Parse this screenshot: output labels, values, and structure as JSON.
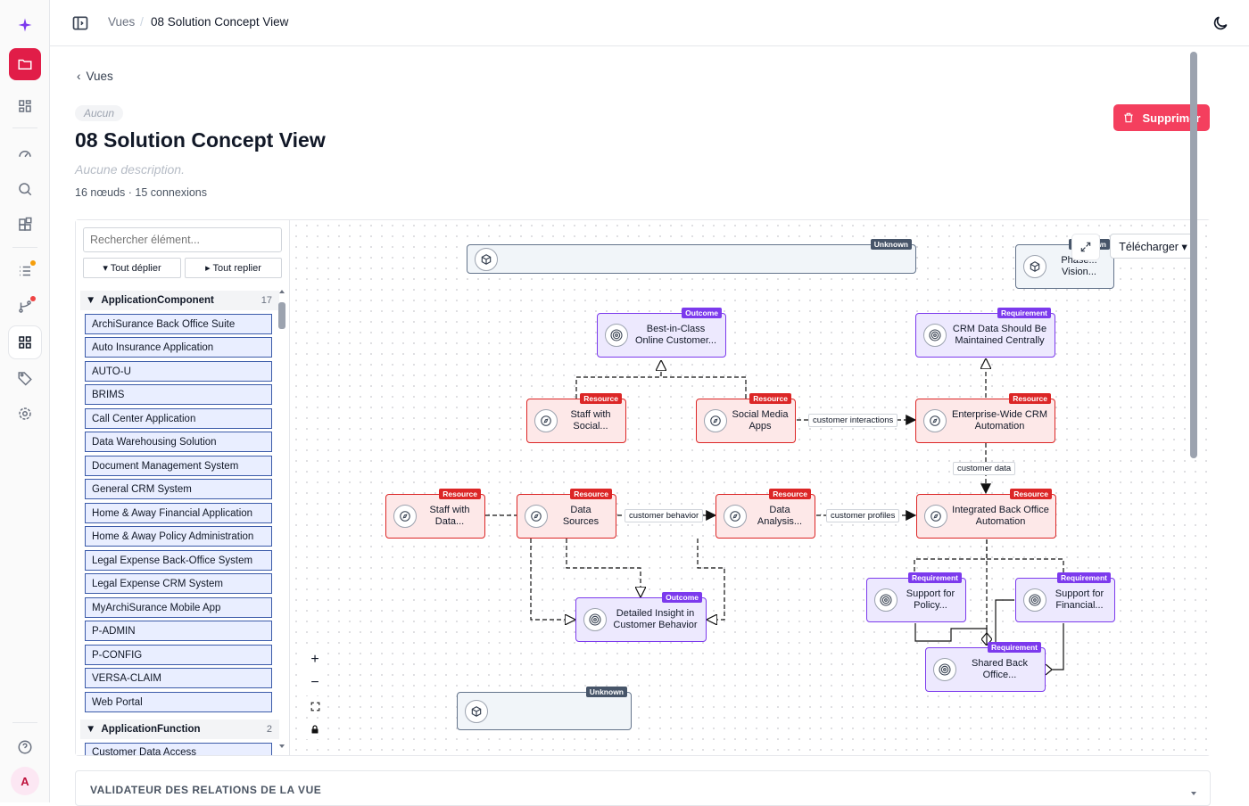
{
  "breadcrumb": {
    "parent": "Vues",
    "current": "08 Solution Concept View"
  },
  "back_label": "Vues",
  "view": {
    "chip": "Aucun",
    "title": "08 Solution Concept View",
    "description": "Aucune description.",
    "counts": "16 nœuds · 15 connexions",
    "delete_label": "Supprimer"
  },
  "sidebar": {
    "search_placeholder": "Rechercher élément...",
    "expand_all": "▾ Tout déplier",
    "collapse_all": "▸ Tout replier",
    "groups": [
      {
        "name": "ApplicationComponent",
        "count": "17"
      },
      {
        "name": "ApplicationFunction",
        "count": "2"
      }
    ],
    "items": [
      "ArchiSurance Back Office Suite",
      "Auto Insurance Application",
      "AUTO-U",
      "BRIMS",
      "Call Center Application",
      "Data Warehousing Solution",
      "Document Management System",
      "General CRM System",
      "Home & Away Financial Application",
      "Home & Away Policy Administration",
      "Legal Expense Back-Office System",
      "Legal Expense CRM System",
      "MyArchiSurance Mobile App",
      "P-ADMIN",
      "P-CONFIG",
      "VERSA-CLAIM",
      "Web Portal",
      "Customer Data Access"
    ]
  },
  "canvas": {
    "download_label": "Télécharger ▾",
    "nodes": [
      {
        "id": "unknown1",
        "tag": "Unknown",
        "label": ""
      },
      {
        "id": "phase",
        "tag": "Unknown",
        "label": "Phase... Vision..."
      },
      {
        "id": "best",
        "tag": "Outcome",
        "label": "Best-in-Class Online Customer..."
      },
      {
        "id": "crmdata",
        "tag": "Requirement",
        "label": "CRM Data Should Be Maintained Centrally"
      },
      {
        "id": "staffsocial",
        "tag": "Resource",
        "label": "Staff with Social..."
      },
      {
        "id": "socialmedia",
        "tag": "Resource",
        "label": "Social Media Apps"
      },
      {
        "id": "crmauto",
        "tag": "Resource",
        "label": "Enterprise-Wide CRM Automation"
      },
      {
        "id": "staffdata",
        "tag": "Resource",
        "label": "Staff with Data..."
      },
      {
        "id": "datasources",
        "tag": "Resource",
        "label": "Data Sources"
      },
      {
        "id": "dataanalysis",
        "tag": "Resource",
        "label": "Data Analysis..."
      },
      {
        "id": "backoffice",
        "tag": "Resource",
        "label": "Integrated Back Office Automation"
      },
      {
        "id": "insight",
        "tag": "Outcome",
        "label": "Detailed Insight in Customer Behavior"
      },
      {
        "id": "policy",
        "tag": "Requirement",
        "label": "Support for Policy..."
      },
      {
        "id": "financial",
        "tag": "Requirement",
        "label": "Support for Financial..."
      },
      {
        "id": "shared",
        "tag": "Requirement",
        "label": "Shared Back Office..."
      },
      {
        "id": "unknown2",
        "tag": "Unknown",
        "label": ""
      }
    ],
    "edge_labels": [
      "customer interactions",
      "customer data",
      "customer behavior",
      "customer profiles"
    ]
  },
  "validator_title": "VALIDATEUR DES RELATIONS DE LA VUE",
  "user_initial": "A",
  "colors": {
    "accent": "#e11d48",
    "resource": "#dc2626",
    "outcome": "#7c3aed",
    "unknown": "#475569",
    "item_border": "#3b5ba9"
  }
}
